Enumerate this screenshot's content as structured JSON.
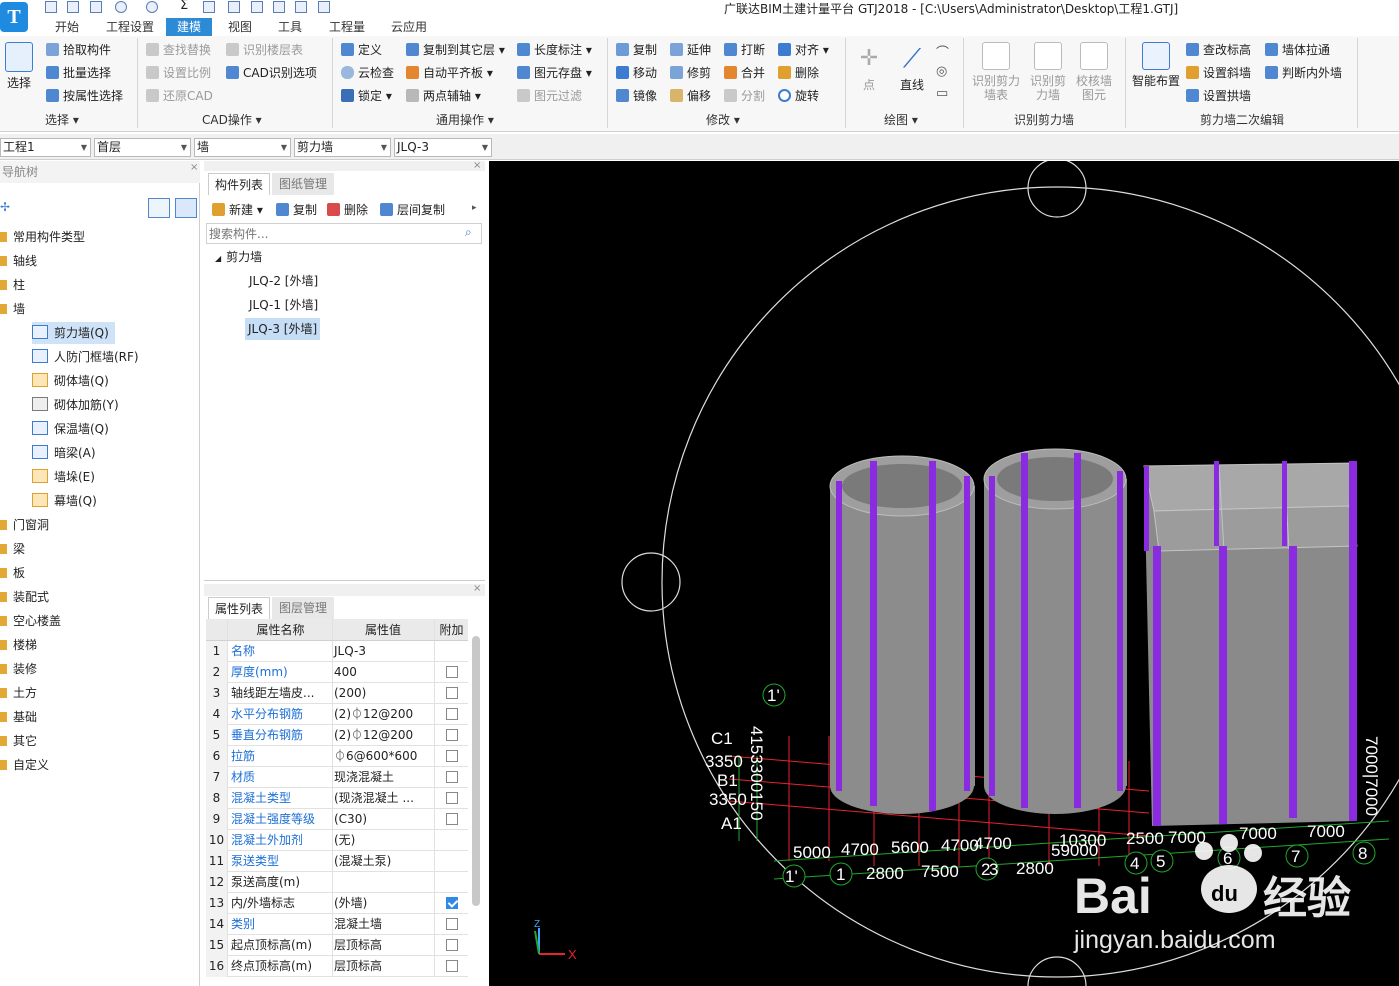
{
  "app": {
    "title": "广联达BIM土建计量平台 GTJ2018 - [C:\\Users\\Administrator\\Desktop\\工程1.GTJ]",
    "logo_letter": "T"
  },
  "tabs": [
    "开始",
    "工程设置",
    "建模",
    "视图",
    "工具",
    "工程量",
    "云应用"
  ],
  "ribbon": {
    "select_big": "选择",
    "select_items": [
      "拾取构件",
      "批量选择",
      "按属性选择"
    ],
    "select_group": "选择",
    "cad_items": [
      "查找替换",
      "识别楼层表",
      "设置比例",
      "CAD识别选项",
      "还原CAD"
    ],
    "cad_group": "CAD操作",
    "common_col1": [
      "定义",
      "云检查",
      "锁定"
    ],
    "common_col2": [
      "复制到其它层",
      "自动平齐板",
      "两点辅轴"
    ],
    "common_col3": [
      "长度标注",
      "图元存盘",
      "图元过滤"
    ],
    "common_group": "通用操作",
    "modify_col1": [
      "复制",
      "移动",
      "镜像"
    ],
    "modify_col2": [
      "延伸",
      "修剪",
      "偏移"
    ],
    "modify_col3": [
      "打断",
      "合并",
      "分割"
    ],
    "modify_col4": [
      "对齐",
      "删除",
      "旋转"
    ],
    "modify_group": "修改",
    "draw_point": "点",
    "draw_line": "直线",
    "draw_group": "绘图",
    "recog_items": [
      "识别剪力墙表",
      "识别剪力墙",
      "校核墙图元"
    ],
    "recog_group": "识别剪力墙",
    "smart_layout": "智能布置",
    "edit2_col1": [
      "查改标高",
      "设置斜墙",
      "设置拱墙"
    ],
    "edit2_col2": [
      "墙体拉通",
      "判断内外墙"
    ],
    "edit2_group": "剪力墙二次编辑"
  },
  "selectors": [
    "工程1",
    "首层",
    "墙",
    "剪力墙",
    "JLQ-3"
  ],
  "nav": {
    "title": "导航树",
    "items": [
      "常用构件类型",
      "轴线",
      "柱",
      "墙"
    ],
    "wall_children": [
      "剪力墙(Q)",
      "人防门框墙(RF)",
      "砌体墙(Q)",
      "砌体加筋(Y)",
      "保温墙(Q)",
      "暗梁(A)",
      "墙垛(E)",
      "幕墙(Q)"
    ],
    "items_after": [
      "门窗洞",
      "梁",
      "板",
      "装配式",
      "空心楼盖",
      "楼梯",
      "装修",
      "土方",
      "基础",
      "其它",
      "自定义"
    ]
  },
  "component_panel": {
    "tab_active": "构件列表",
    "tab_other": "图纸管理",
    "toolbar": [
      "新建",
      "复制",
      "删除",
      "层间复制"
    ],
    "search_placeholder": "搜索构件...",
    "group": "剪力墙",
    "items": [
      "JLQ-2 [外墙]",
      "JLQ-1 [外墙]",
      "JLQ-3 [外墙]"
    ],
    "selected_index": 2
  },
  "property_panel": {
    "tab_active": "属性列表",
    "tab_other": "图层管理",
    "headers": [
      "属性名称",
      "属性值",
      "附加"
    ],
    "rows": [
      {
        "n": "1",
        "name": "名称",
        "value": "JLQ-3",
        "link": true,
        "check": null
      },
      {
        "n": "2",
        "name": "厚度(mm)",
        "value": "400",
        "link": true,
        "check": false
      },
      {
        "n": "3",
        "name": "轴线距左墙皮...",
        "value": "(200)",
        "link": false,
        "check": false
      },
      {
        "n": "4",
        "name": "水平分布钢筋",
        "value": "(2)⏀12@200",
        "link": true,
        "check": false
      },
      {
        "n": "5",
        "name": "垂直分布钢筋",
        "value": "(2)⏀12@200",
        "link": true,
        "check": false
      },
      {
        "n": "6",
        "name": "拉筋",
        "value": "⏀6@600*600",
        "link": true,
        "check": false
      },
      {
        "n": "7",
        "name": "材质",
        "value": "现浇混凝土",
        "link": true,
        "check": false
      },
      {
        "n": "8",
        "name": "混凝土类型",
        "value": "(现浇混凝土 ...",
        "link": true,
        "check": false
      },
      {
        "n": "9",
        "name": "混凝土强度等级",
        "value": "(C30)",
        "link": true,
        "check": false
      },
      {
        "n": "10",
        "name": "混凝土外加剂",
        "value": "(无)",
        "link": true,
        "check": null
      },
      {
        "n": "11",
        "name": "泵送类型",
        "value": "(混凝土泵)",
        "link": true,
        "check": null
      },
      {
        "n": "12",
        "name": "泵送高度(m)",
        "value": "",
        "link": false,
        "check": null
      },
      {
        "n": "13",
        "name": "内/外墙标志",
        "value": "(外墙)",
        "link": false,
        "check": true
      },
      {
        "n": "14",
        "name": "类别",
        "value": "混凝土墙",
        "link": true,
        "check": false
      },
      {
        "n": "15",
        "name": "起点顶标高(m)",
        "value": "层顶标高",
        "link": false,
        "check": false
      },
      {
        "n": "16",
        "name": "终点顶标高(m)",
        "value": "层顶标高",
        "link": false,
        "check": false
      }
    ]
  },
  "viewport": {
    "axis_bubbles": [
      "1'",
      "C1",
      "B1",
      "A1",
      "1'",
      "1",
      "2",
      "3",
      "4",
      "5",
      "6",
      "7",
      "8"
    ],
    "dims_bottom": [
      "5000",
      "4700",
      "5600",
      "4700",
      "4700",
      "10300",
      "2500",
      "7000",
      "7000",
      "7000"
    ],
    "dims_bottom2": [
      "2800",
      "7500",
      "2800",
      "59000"
    ],
    "dims_left": [
      "3350",
      "3350"
    ],
    "dims_vertical": [
      "4153300150",
      "7000|7000"
    ],
    "axis_label_x": "X",
    "axis_label_z": "Z",
    "watermark_main": "Bai",
    "watermark_du": "du",
    "watermark_cn": "经验",
    "watermark_url": "jingyan.baidu.com",
    "colors": {
      "background": "#000000",
      "wall": "#8c8c8c",
      "column": "#8a2be2",
      "grid": "#e8222e",
      "dim": "#1fa82b"
    }
  }
}
